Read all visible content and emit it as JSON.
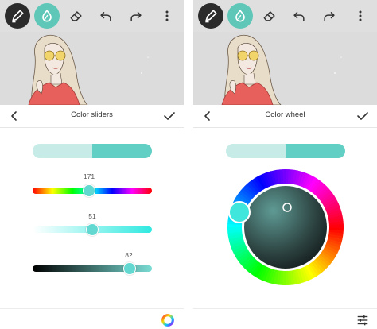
{
  "toolbar": {
    "icons": [
      "brush-icon",
      "fill-drop-icon",
      "eraser-icon",
      "undo-icon",
      "redo-icon",
      "more-vertical-icon"
    ]
  },
  "colors": {
    "teal_accent": "#5fc7b8",
    "old_color": "#c7ece8",
    "new_color": "#62cfc4",
    "thumb": "#62d8d0"
  },
  "left_panel": {
    "title": "Color sliders",
    "sliders": [
      {
        "name": "hue",
        "value": "171",
        "fraction": 0.47
      },
      {
        "name": "saturation",
        "value": "51",
        "fraction": 0.51
      },
      {
        "name": "value",
        "value": "82",
        "fraction": 0.82
      }
    ],
    "bottom_icon": "color-wheel-icon"
  },
  "right_panel": {
    "title": "Color wheel",
    "bottom_icon": "sliders-icon"
  }
}
